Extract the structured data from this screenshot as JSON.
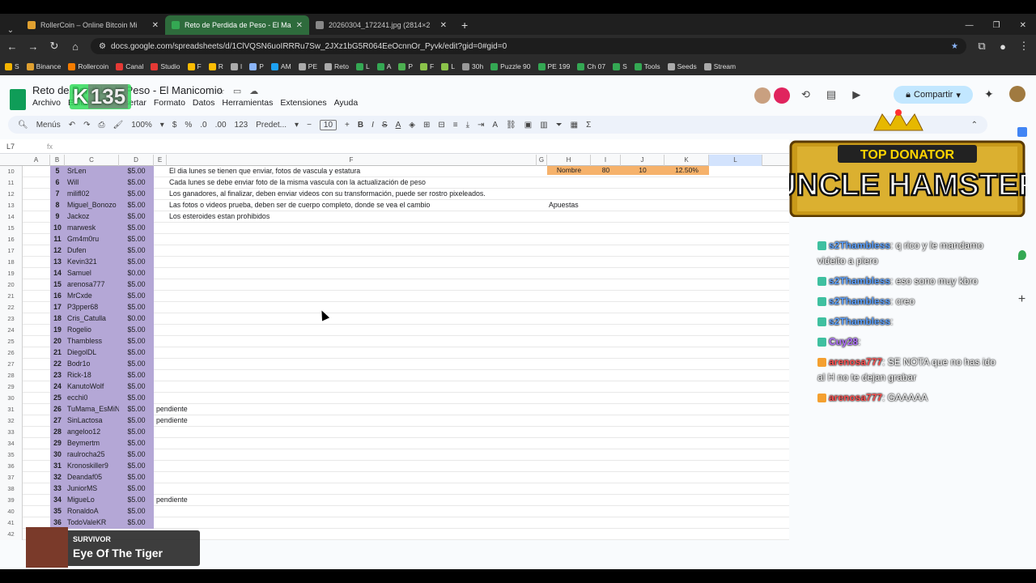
{
  "browser": {
    "tabs": [
      {
        "title": "RollerCoin – Online Bitcoin Mi",
        "color": "#e0a030"
      },
      {
        "title": "Reto de Perdida de Peso - El Ma",
        "color": "#34a853",
        "active": true
      },
      {
        "title": "20260304_172241.jpg (2814×2",
        "color": "#888888"
      }
    ],
    "url": "docs.google.com/spreadsheets/d/1ClVQSN6uoIRRRu7Sw_2JXz1bG5R064EeOcnnOr_Pyvk/edit?gid=0#gid=0",
    "bookmarks": [
      "S",
      "Binance",
      "Rollercoin",
      "Canal",
      "Studio",
      "F",
      "R",
      "I",
      "P",
      "AM",
      "PE",
      "Reto",
      "L",
      "A",
      "P",
      "F",
      "L",
      "30h",
      "Puzzle 90",
      "PE 199",
      "Ch 07",
      "S",
      "Tools",
      "Seeds",
      "Stream"
    ]
  },
  "doc": {
    "title": "Reto de Perdida de Peso - El Manicomio",
    "menus": [
      "Archivo",
      "Editar",
      "Ver",
      "Insertar",
      "Formato",
      "Datos",
      "Herramientas",
      "Extensiones",
      "Ayuda"
    ],
    "share": "Compartir",
    "badge_k": "K",
    "badge_num": "135"
  },
  "toolbar": {
    "search": "Menús",
    "zoom": "100%",
    "currency": "$",
    "percent": "%",
    "dec1": ".0",
    "dec2": ".00",
    "numfmt": "123",
    "font": "Predet...",
    "fontsize": "10"
  },
  "formula": {
    "cell": "L7",
    "fx": "fx"
  },
  "columns": [
    "A",
    "B",
    "C",
    "D",
    "E",
    "F",
    "G",
    "H",
    "I",
    "J",
    "K",
    "L"
  ],
  "header_cells": {
    "h": "Nombre",
    "i": "80",
    "j": "10",
    "k": "12.50%"
  },
  "rows": [
    {
      "r": "10",
      "n": "5",
      "name": "SrLen",
      "amt": "$5.00",
      "f": "El dia lunes se tienen que enviar, fotos de vascula y estatura"
    },
    {
      "r": "11",
      "n": "6",
      "name": "Will",
      "amt": "$5.00",
      "f": "Cada lunes se debe enviar foto de la misma vascula con la actualización de peso"
    },
    {
      "r": "12",
      "n": "7",
      "name": "milifl02",
      "amt": "$5.00",
      "f": "Los ganadores, al finalizar, deben enviar videos con su transformación, puede ser rostro pixeleados."
    },
    {
      "r": "13",
      "n": "8",
      "name": "Miguel_Bonozo",
      "amt": "$5.00",
      "f": "Las fotos o videos prueba, deben ser de cuerpo completo, donde se vea el cambio",
      "h": "Apuestas"
    },
    {
      "r": "14",
      "n": "9",
      "name": "Jackoz",
      "amt": "$5.00",
      "f": "Los esteroides estan prohibidos"
    },
    {
      "r": "15",
      "n": "10",
      "name": "marwesk",
      "amt": "$5.00"
    },
    {
      "r": "16",
      "n": "11",
      "name": "Gm4m0ru",
      "amt": "$5.00"
    },
    {
      "r": "17",
      "n": "12",
      "name": "Dufen",
      "amt": "$5.00"
    },
    {
      "r": "18",
      "n": "13",
      "name": "Kevin321",
      "amt": "$5.00"
    },
    {
      "r": "19",
      "n": "14",
      "name": "Samuel",
      "amt": "$0.00"
    },
    {
      "r": "20",
      "n": "15",
      "name": "arenosa777",
      "amt": "$5.00"
    },
    {
      "r": "21",
      "n": "16",
      "name": "MrCxde",
      "amt": "$5.00"
    },
    {
      "r": "22",
      "n": "17",
      "name": "P3pper68",
      "amt": "$5.00"
    },
    {
      "r": "23",
      "n": "18",
      "name": "Cris_Catulla",
      "amt": "$0.00"
    },
    {
      "r": "24",
      "n": "19",
      "name": "Rogelio",
      "amt": "$5.00"
    },
    {
      "r": "25",
      "n": "20",
      "name": "Thambless",
      "amt": "$5.00"
    },
    {
      "r": "26",
      "n": "21",
      "name": "DiegolDL",
      "amt": "$5.00"
    },
    {
      "r": "27",
      "n": "22",
      "name": "Bodr1o",
      "amt": "$5.00"
    },
    {
      "r": "28",
      "n": "23",
      "name": "Rick-18",
      "amt": "$5.00"
    },
    {
      "r": "29",
      "n": "24",
      "name": "KanutoWolf",
      "amt": "$5.00"
    },
    {
      "r": "30",
      "n": "25",
      "name": "ecchi0",
      "amt": "$5.00"
    },
    {
      "r": "31",
      "n": "26",
      "name": "TuMama_EsMiN",
      "amt": "$5.00",
      "e": "pendiente"
    },
    {
      "r": "32",
      "n": "27",
      "name": "SinLactosa",
      "amt": "$5.00",
      "e": "pendiente"
    },
    {
      "r": "33",
      "n": "28",
      "name": "angeloo12",
      "amt": "$5.00"
    },
    {
      "r": "34",
      "n": "29",
      "name": "Beymertm",
      "amt": "$5.00"
    },
    {
      "r": "35",
      "n": "30",
      "name": "raulrocha25",
      "amt": "$5.00"
    },
    {
      "r": "36",
      "n": "31",
      "name": "Kronoskiller9",
      "amt": "$5.00"
    },
    {
      "r": "37",
      "n": "32",
      "name": "Deandaf05",
      "amt": "$5.00"
    },
    {
      "r": "38",
      "n": "33",
      "name": "JuniorMS",
      "amt": "$5.00"
    },
    {
      "r": "39",
      "n": "34",
      "name": "MigueLo",
      "amt": "$5.00",
      "e": "pendiente"
    },
    {
      "r": "40",
      "n": "35",
      "name": "RonaldoA",
      "amt": "$5.00"
    },
    {
      "r": "41",
      "n": "36",
      "name": "TodoValeKR",
      "amt": "$5.00"
    },
    {
      "r": "42",
      "n": "",
      "name": "",
      "amt": ""
    },
    {
      "r": "43",
      "n": "",
      "name": "",
      "amt": ""
    }
  ],
  "overlay": {
    "donor_top": "TOP DONATOR",
    "donor_name": "UNCLE HAMSTER",
    "chat": [
      {
        "user": "s2Thambless",
        "color": "#5aa0ff",
        "text": ": q rico y le mandamo videito a piero"
      },
      {
        "user": "s2Thambless",
        "color": "#5aa0ff",
        "text": ": eso sono muy kbro"
      },
      {
        "user": "s2Thambless",
        "color": "#5aa0ff",
        "text": ": creo"
      },
      {
        "user": "s2Thambless",
        "color": "#5aa0ff",
        "text": ": "
      },
      {
        "user": "Cuy28",
        "color": "#b070ff",
        "text": ": "
      },
      {
        "user": "arenosa777",
        "color": "#ff5050",
        "text": ": SE NOTA que no has ido al H no te dejan grabar"
      },
      {
        "user": "arenosa777",
        "color": "#ff5050",
        "text": ": GAAAAA"
      }
    ],
    "music_label": "SURVIVOR",
    "music_title": "Eye Of The Tiger"
  }
}
